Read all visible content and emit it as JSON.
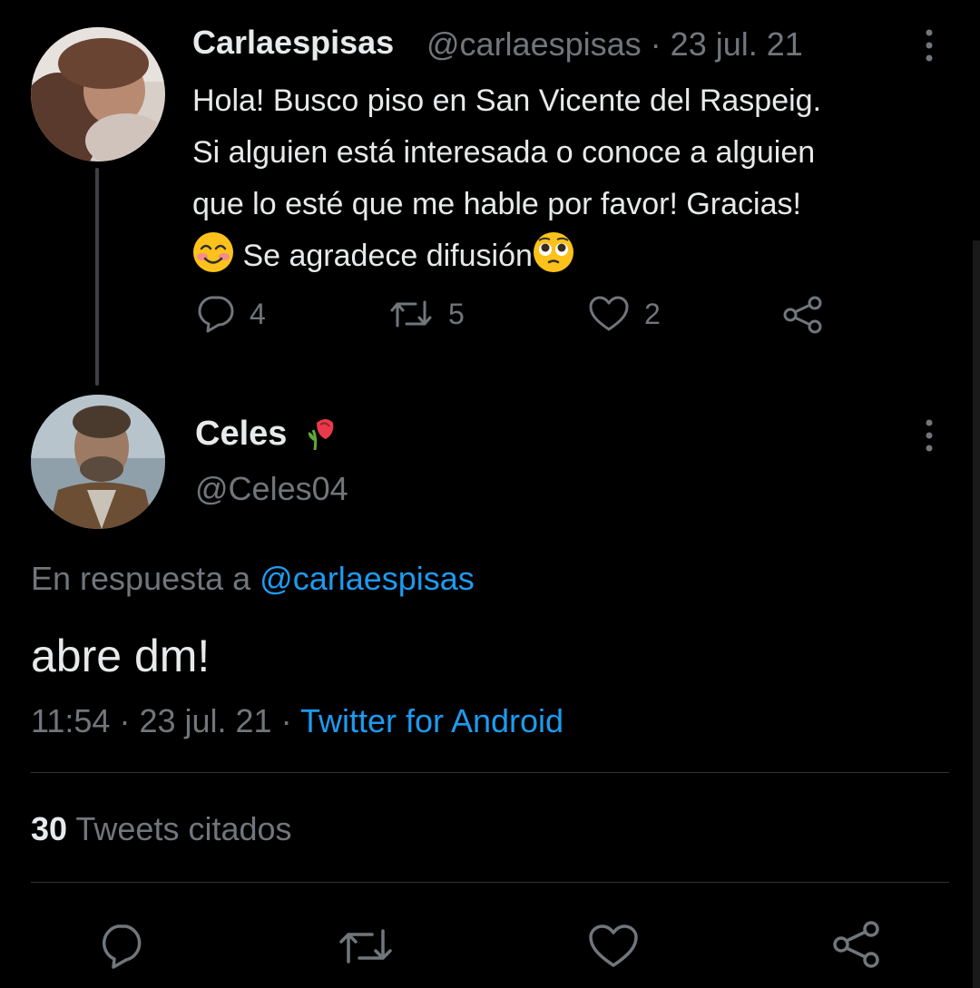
{
  "first_tweet": {
    "author_name": "Carlaespisas",
    "handle": "@carlaespisas",
    "separator": "·",
    "date": "23 jul. 21",
    "text_lines": [
      "Hola! Busco piso en San Vicente del Raspeig.",
      "Si alguien está interesada o conoce a alguien",
      "que lo esté que me hable por favor! Gracias!"
    ],
    "text_last": "Se agradece difusión",
    "reply_count": "4",
    "retweet_count": "5",
    "like_count": "2"
  },
  "main_tweet": {
    "author_name": "Celes",
    "handle": "@Celes04",
    "reply_to_prefix": "En respuesta a",
    "reply_to_handle": "@carlaespisas",
    "text": "abre dm!",
    "time": "11:54",
    "separator": "·",
    "date": "23 jul. 21",
    "source": "Twitter for Android",
    "quote_count": "30",
    "quote_label": "Tweets citados"
  },
  "colors": {
    "background": "#000000",
    "text": "#e7e9ea",
    "muted": "#71767b",
    "link": "#1d9bf0"
  }
}
